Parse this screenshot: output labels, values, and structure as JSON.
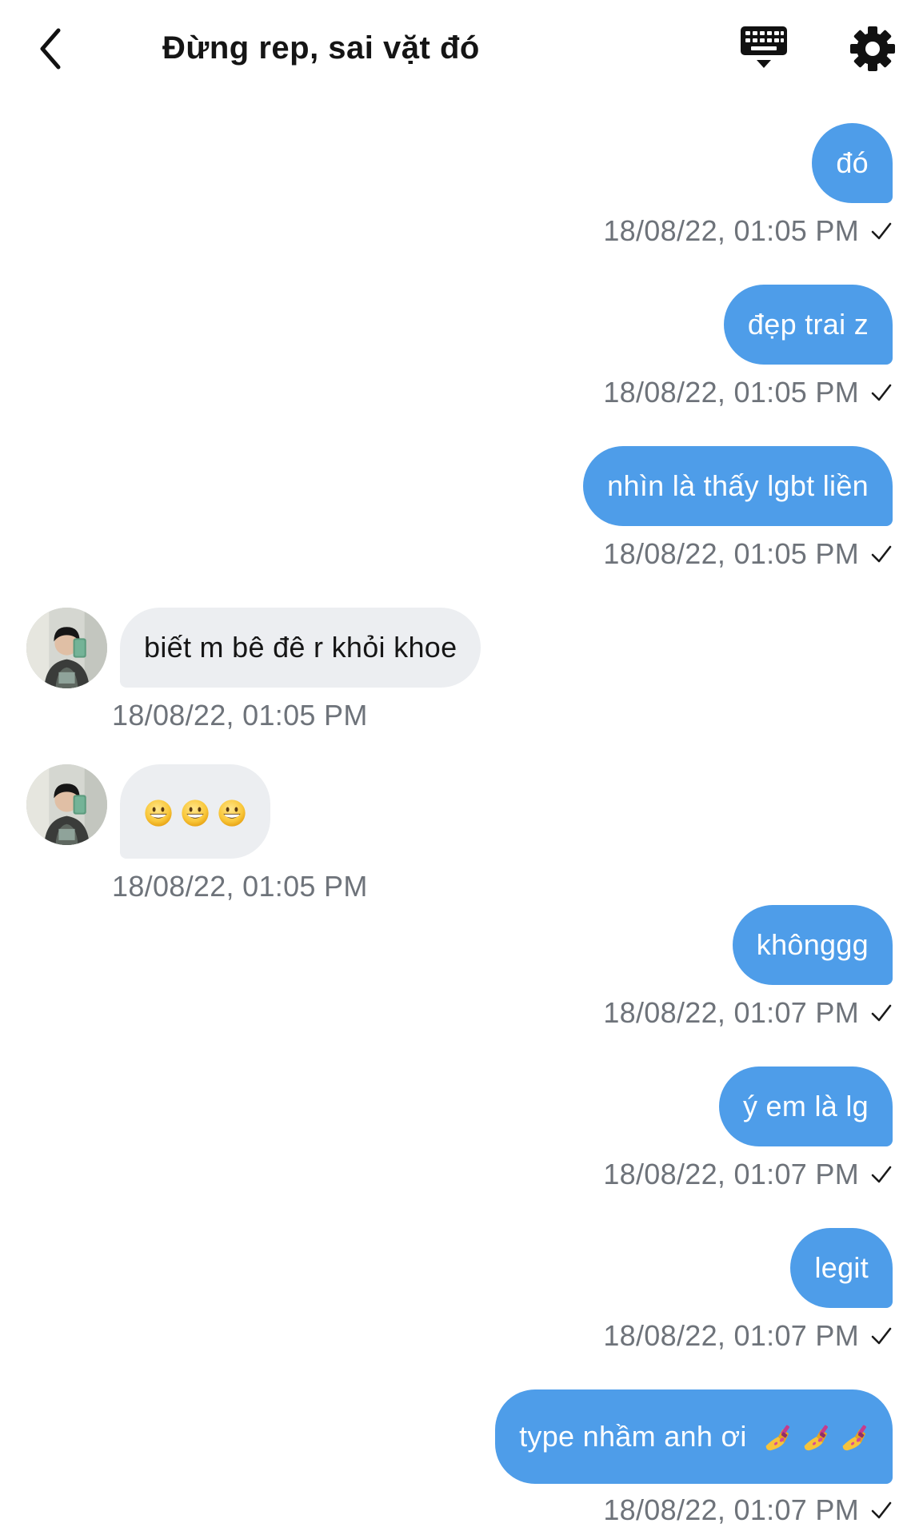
{
  "header": {
    "title": "Đừng rep, sai vặt đó",
    "icons": {
      "back": "chevron-left-icon",
      "keyboard": "keyboard-icon",
      "settings": "gear-icon"
    }
  },
  "colors": {
    "outgoing_bubble": "#4e9de9",
    "incoming_bubble": "#eceef1",
    "timestamp": "#6e737a"
  },
  "messages": [
    {
      "direction": "outgoing",
      "text": "đó",
      "time": "18/08/22, 01:05 PM",
      "status": "sent-check-icon"
    },
    {
      "direction": "outgoing",
      "text": "đẹp trai z",
      "time": "18/08/22, 01:05 PM",
      "status": "sent-check-icon"
    },
    {
      "direction": "outgoing",
      "text": "nhìn là thấy lgbt liền",
      "time": "18/08/22, 01:05 PM",
      "status": "sent-check-icon"
    },
    {
      "direction": "incoming",
      "text": "biết m bê đê r khỏi khoe",
      "time": "18/08/22, 01:05 PM",
      "avatar": "contact-avatar"
    },
    {
      "direction": "incoming",
      "text": "",
      "emoji": [
        "grinning-face-emoji",
        "grinning-face-emoji",
        "grinning-face-emoji"
      ],
      "time": "18/08/22, 01:05 PM",
      "avatar": "contact-avatar"
    },
    {
      "direction": "outgoing",
      "text": "khônggg",
      "time": "18/08/22, 01:07 PM",
      "status": "sent-check-icon"
    },
    {
      "direction": "outgoing",
      "text": "ý em là lg",
      "time": "18/08/22, 01:07 PM",
      "status": "sent-check-icon"
    },
    {
      "direction": "outgoing",
      "text": "legit",
      "time": "18/08/22, 01:07 PM",
      "status": "sent-check-icon"
    },
    {
      "direction": "outgoing",
      "text": "type nhầm anh ơi",
      "emoji": [
        "nail-polish-emoji",
        "nail-polish-emoji",
        "nail-polish-emoji"
      ],
      "time": "18/08/22, 01:07 PM",
      "status": "sent-check-icon"
    }
  ]
}
